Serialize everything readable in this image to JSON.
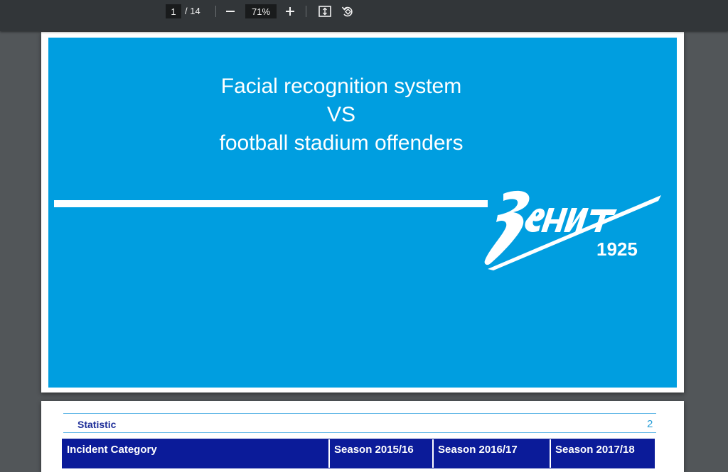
{
  "toolbar": {
    "page_current": "1",
    "page_total": "/ 14",
    "zoom_out_icon": "minus-icon",
    "zoom_value": "71%",
    "zoom_in_icon": "plus-icon",
    "fit_icon": "fit-to-page-icon",
    "rotate_icon": "rotate-icon"
  },
  "slide1": {
    "title_lines": [
      "Facial recognition system",
      "VS",
      "football stadium offenders"
    ],
    "logo_text": "Зенит",
    "logo_year": "1925",
    "background_color": "#009ee0"
  },
  "slide2": {
    "heading": "Statistic",
    "page_number": "2",
    "table_headers": [
      "Incident Category",
      "Season 2015/16",
      "Season 2016/17",
      "Season 2017/18"
    ]
  }
}
